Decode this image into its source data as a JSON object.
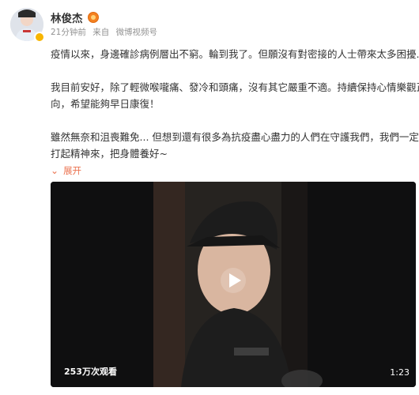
{
  "post": {
    "author": "林俊杰",
    "time": "21分钟前",
    "source_prefix": "来自",
    "source": "微博视频号",
    "paragraphs": [
      "疫情以來，身邊確診病例層出不窮。輪到我了。但願沒有對密接的人士帶來太多困擾...",
      "我目前安好，除了輕微喉嚨痛、發冷和頭痛，沒有其它嚴重不適。持續保持心情樂觀正",
      "向，希望能夠早日康復！",
      "雖然無奈和沮喪難免... 但想到還有很多為抗疫盡心盡力的人們在守護我們，我們一定要",
      "打起精神來，把身體養好~"
    ],
    "expand_label": "展开"
  },
  "video": {
    "view_count": "253万次观看",
    "duration": "1:23"
  },
  "icons": {
    "play": "play-icon",
    "expand": "chevron-down-icon",
    "badge": "vip-badge-icon"
  },
  "colors": {
    "link": "#eb7350",
    "meta": "#939393",
    "text": "#333333"
  }
}
